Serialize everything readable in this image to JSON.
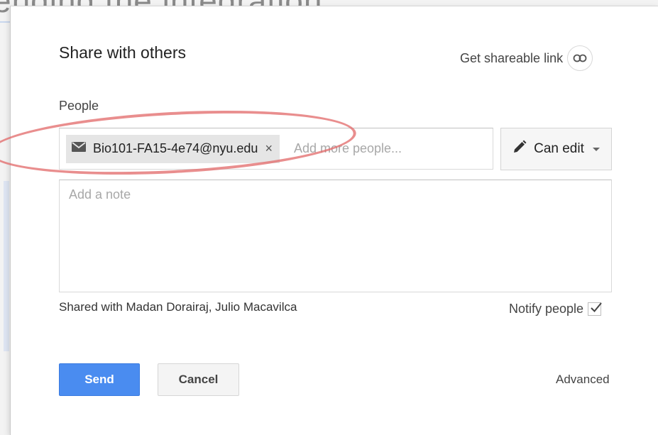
{
  "background": {
    "title_fragment": "ending the integration"
  },
  "dialog": {
    "title": "Share with others",
    "share_link_label": "Get shareable link",
    "people_label": "People",
    "chip_email": "Bio101-FA15-4e74@nyu.edu",
    "chip_remove": "×",
    "add_people_placeholder": "Add more people...",
    "permission_label": "Can edit",
    "note_placeholder": "Add a note",
    "shared_with": "Shared with Madan Dorairaj, Julio Macavilca",
    "notify_label": "Notify people",
    "notify_checked": true,
    "send_label": "Send",
    "cancel_label": "Cancel",
    "advanced_label": "Advanced"
  },
  "icons": {
    "link": "link-icon",
    "email": "email-icon",
    "edit": "pencil-icon",
    "dropdown": "caret-down-icon",
    "check": "checkmark-icon"
  },
  "colors": {
    "primary": "#4a8cf0",
    "annotation": "#e26868",
    "chip_bg": "#e5e5e5"
  }
}
